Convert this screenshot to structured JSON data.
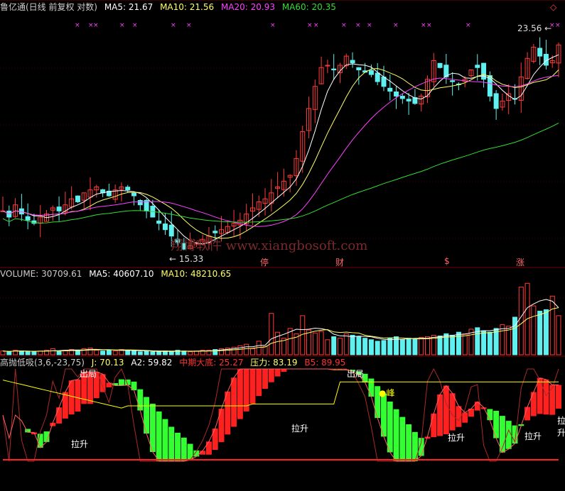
{
  "colors": {
    "bg": "#000000",
    "up": "#ff3b3b",
    "down": "#5ff0f0",
    "ma5": "#ffffff",
    "ma10": "#ffff66",
    "ma20": "#ff40ff",
    "ma60": "#33dd33",
    "grid": "#7a0000",
    "green_bar": "#33ff33",
    "red_bar": "#ff2020",
    "yellow": "#ffff00",
    "white": "#ffffff",
    "title": "#cccccc"
  },
  "price_panel": {
    "title": "鲁亿通(日线 前复权 对数)",
    "ma5_label": "MA5: 21.67",
    "ma10_label": "MA10: 21.56",
    "ma20_label": "MA20: 20.93",
    "ma60_label": "MA60: 20.35",
    "high_mark": "23.56",
    "low_mark": "15.33",
    "event_tags": [
      "停",
      "财",
      "$",
      "涨"
    ],
    "settings_icon": "diamond-icon"
  },
  "volume_panel": {
    "title": "VOLUME: 30709.61",
    "ma5_label": "MA5: 40607.10",
    "ma10_label": "MA10: 48210.65"
  },
  "indicator_panel": {
    "title": "高抛低吸(3,6,-23,75)",
    "j_label": "J: 70.13",
    "a2_label": "A2: 59.82",
    "mid_label": "中期大底: 25.27",
    "pressure_label": "压力: 83.19",
    "b5_label": "B5: 89.95",
    "out_labels": [
      "出局",
      "出局"
    ],
    "peak_label": "●峰",
    "rise_labels": [
      "拉升",
      "拉升",
      "拉升",
      "拉升",
      "拉升"
    ]
  },
  "chart_data": [
    {
      "type": "candlestick",
      "title": "鲁亿通(日线 前复权 对数)",
      "series": [
        {
          "name": "MA5",
          "last": 21.67
        },
        {
          "name": "MA10",
          "last": 21.56
        },
        {
          "name": "MA20",
          "last": 20.93
        },
        {
          "name": "MA60",
          "last": 20.35
        }
      ],
      "annotations": [
        {
          "label": "23.56",
          "kind": "period high"
        },
        {
          "label": "15.33",
          "kind": "period low"
        }
      ],
      "close": [
        16.6,
        16.4,
        16.8,
        16.5,
        16.3,
        16.2,
        16.4,
        16.5,
        16.7,
        16.6,
        16.8,
        17.0,
        16.9,
        17.2,
        17.3,
        17.4,
        17.2,
        17.1,
        17.3,
        17.4,
        17.3,
        17.1,
        16.8,
        16.6,
        16.4,
        16.2,
        16.0,
        15.8,
        15.6,
        15.4,
        15.5,
        15.6,
        15.7,
        15.8,
        15.9,
        16.0,
        16.1,
        16.2,
        16.3,
        16.5,
        16.7,
        16.9,
        17.0,
        17.2,
        17.4,
        17.6,
        17.8,
        18.4,
        19.4,
        20.3,
        21.2,
        22.0,
        22.1,
        21.9,
        22.1,
        22.5,
        22.2,
        21.9,
        21.8,
        21.7,
        21.4,
        21.2,
        21.0,
        20.8,
        20.7,
        20.6,
        20.5,
        20.8,
        21.5,
        22.3,
        22.0,
        21.6,
        21.4,
        21.3,
        21.5,
        21.9,
        22.0,
        21.5,
        20.8,
        20.3,
        20.6,
        20.9,
        20.7,
        21.6,
        22.4,
        22.9,
        22.5,
        22.1,
        22.3,
        23.0
      ]
    },
    {
      "type": "bar",
      "title": "VOLUME",
      "series": [
        {
          "name": "VOLUME",
          "last": 30709.61
        },
        {
          "name": "MA5",
          "last": 40607.1
        },
        {
          "name": "MA10",
          "last": 48210.65
        }
      ],
      "values": [
        5,
        4,
        6,
        5,
        4,
        4,
        5,
        6,
        8,
        5,
        6,
        7,
        6,
        8,
        9,
        6,
        5,
        6,
        5,
        7,
        6,
        5,
        4,
        5,
        4,
        4,
        5,
        4,
        6,
        5,
        4,
        5,
        6,
        6,
        7,
        8,
        9,
        10,
        12,
        14,
        8,
        18,
        11,
        55,
        30,
        22,
        35,
        28,
        52,
        33,
        29,
        31,
        20,
        24,
        22,
        28,
        26,
        24,
        22,
        20,
        18,
        19,
        22,
        24,
        20,
        22,
        21,
        23,
        24,
        26,
        25,
        28,
        26,
        30,
        28,
        34,
        36,
        32,
        30,
        35,
        40,
        38,
        50,
        90,
        95,
        65,
        58,
        60,
        78,
        52
      ]
    },
    {
      "type": "line",
      "title": "高抛低吸(3,6,-23,75)",
      "series": [
        {
          "name": "J",
          "last": 70.13
        },
        {
          "name": "A2",
          "last": 59.82
        },
        {
          "name": "中期大底",
          "last": 25.27
        },
        {
          "name": "压力",
          "last": 83.19
        },
        {
          "name": "B5",
          "last": 89.95
        }
      ]
    }
  ]
}
